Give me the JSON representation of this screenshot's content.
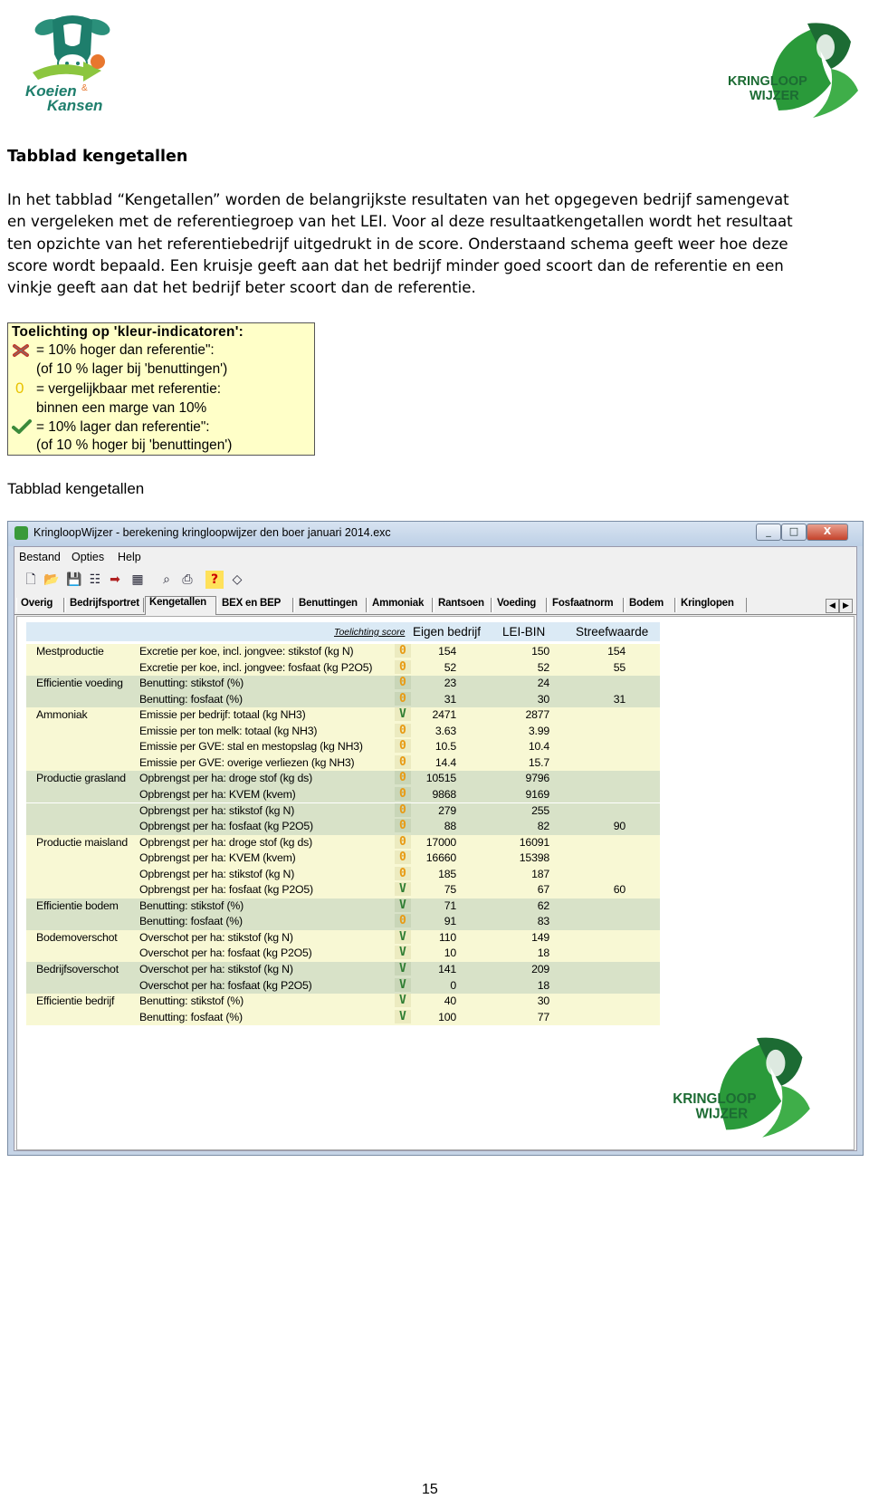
{
  "logos": {
    "left": {
      "name": "Koeien & Kansen",
      "line1": "Koeien",
      "amp": "&",
      "line2": "Kansen"
    },
    "right": {
      "line1": "KRINGLOOP",
      "line2": "WIJZER"
    }
  },
  "heading": "Tabblad kengetallen",
  "intro_lines": [
    "In het tabblad “Kengetallen” worden de belangrijkste resultaten van het opgegeven bedrijf samengevat",
    "en vergeleken met de referentiegroep van het LEI. Voor al deze resultaatkengetallen wordt het resultaat",
    "ten opzichte van het referentiebedrijf uitgedrukt in de score. Onderstaand schema geeft weer hoe deze",
    "score wordt bepaald. Een kruisje geeft aan dat het bedrijf minder goed scoort dan de referentie en een",
    "vinkje geeft aan dat het bedrijf beter scoort dan de referentie."
  ],
  "legend": {
    "title": "Toelichting op 'kleur-indicatoren':",
    "items": [
      {
        "icon": "cross-icon",
        "lines": [
          "= 10% hoger dan referentie\":",
          "(of 10 % lager bij 'benuttingen')"
        ]
      },
      {
        "icon": "zero-icon",
        "symbol": "0",
        "lines": [
          "= vergelijkbaar met referentie:",
          "binnen een marge van 10%"
        ]
      },
      {
        "icon": "check-icon",
        "lines": [
          "= 10% lager dan referentie\":",
          "(of 10 % hoger bij 'benuttingen')"
        ]
      }
    ]
  },
  "subheading": "Tabblad kengetallen",
  "window": {
    "title": "KringloopWijzer - berekening kringloopwijzer den boer januari 2014.exc",
    "controls": [
      "_",
      "□",
      "X"
    ],
    "menu": [
      "Bestand",
      "Opties",
      "Help"
    ],
    "toolbar_icons": [
      "new-file-icon",
      "open-folder-icon",
      "save-icon",
      "print-preview-icon",
      "export-icon",
      "calculator-icon",
      "find-icon",
      "print-icon",
      "help-icon",
      "erase-icon"
    ],
    "tabs": [
      "Overig",
      "Bedrijfsportret",
      "Kengetallen",
      "BEX en BEP",
      "Benuttingen",
      "Ammoniak",
      "Rantsoen",
      "Voeding",
      "Fosfaatnorm",
      "Bodem",
      "Kringlopen"
    ],
    "active_tab": "Kengetallen",
    "table": {
      "toelichting_link": "Toelichting score",
      "columns": [
        "Eigen bedrijf",
        "LEI-BIN",
        "Streefwaarde"
      ],
      "rows": [
        {
          "group": "Mestproductie",
          "label": "Excretie per koe, incl. jongvee: stikstof (kg N)",
          "score": "0",
          "eigen": "154",
          "lei": "150",
          "streef": "154",
          "shade": 1
        },
        {
          "group": "",
          "label": "Excretie per koe, incl. jongvee: fosfaat (kg P2O5)",
          "score": "0",
          "eigen": "52",
          "lei": "52",
          "streef": "55",
          "shade": 1
        },
        {
          "group": "Efficientie voeding",
          "label": "Benutting: stikstof (%)",
          "score": "0",
          "eigen": "23",
          "lei": "24",
          "streef": "",
          "shade": 2
        },
        {
          "group": "",
          "label": "Benutting: fosfaat (%)",
          "score": "0",
          "eigen": "31",
          "lei": "30",
          "streef": "31",
          "shade": 2
        },
        {
          "group": "Ammoniak",
          "label": "Emissie per bedrijf: totaal (kg NH3)",
          "score": "V",
          "eigen": "2471",
          "lei": "2877",
          "streef": "",
          "shade": 1
        },
        {
          "group": "",
          "label": "Emissie per ton melk: totaal (kg NH3)",
          "score": "0",
          "eigen": "3.63",
          "lei": "3.99",
          "streef": "",
          "shade": 1
        },
        {
          "group": "",
          "label": "Emissie per GVE: stal en mestopslag (kg NH3)",
          "score": "0",
          "eigen": "10.5",
          "lei": "10.4",
          "streef": "",
          "shade": 1
        },
        {
          "group": "",
          "label": "Emissie per GVE: overige verliezen (kg NH3)",
          "score": "0",
          "eigen": "14.4",
          "lei": "15.7",
          "streef": "",
          "shade": 1
        },
        {
          "group": "Productie grasland",
          "label": "Opbrengst per ha: droge stof (kg ds)",
          "score": "0",
          "eigen": "10515",
          "lei": "9796",
          "streef": "",
          "shade": 2
        },
        {
          "group": "",
          "label": "Opbrengst per ha: KVEM (kvem)",
          "score": "0",
          "eigen": "9868",
          "lei": "9169",
          "streef": "",
          "shade": 2
        },
        {
          "group": "",
          "label": "Opbrengst per ha: stikstof (kg N)",
          "score": "0",
          "eigen": "279",
          "lei": "255",
          "streef": "",
          "shade": 2
        },
        {
          "group": "",
          "label": "Opbrengst per ha: fosfaat (kg P2O5)",
          "score": "0",
          "eigen": "88",
          "lei": "82",
          "streef": "90",
          "shade": 2
        },
        {
          "group": "Productie maisland",
          "label": "Opbrengst per ha: droge stof (kg ds)",
          "score": "0",
          "eigen": "17000",
          "lei": "16091",
          "streef": "",
          "shade": 1
        },
        {
          "group": "",
          "label": "Opbrengst per ha: KVEM (kvem)",
          "score": "0",
          "eigen": "16660",
          "lei": "15398",
          "streef": "",
          "shade": 1
        },
        {
          "group": "",
          "label": "Opbrengst per ha: stikstof (kg N)",
          "score": "0",
          "eigen": "185",
          "lei": "187",
          "streef": "",
          "shade": 1
        },
        {
          "group": "",
          "label": "Opbrengst per ha: fosfaat (kg P2O5)",
          "score": "V",
          "eigen": "75",
          "lei": "67",
          "streef": "60",
          "shade": 1
        },
        {
          "group": "Efficientie bodem",
          "label": "Benutting: stikstof (%)",
          "score": "V",
          "eigen": "71",
          "lei": "62",
          "streef": "",
          "shade": 2
        },
        {
          "group": "",
          "label": "Benutting: fosfaat (%)",
          "score": "0",
          "eigen": "91",
          "lei": "83",
          "streef": "",
          "shade": 2
        },
        {
          "group": "Bodemoverschot",
          "label": "Overschot per ha: stikstof (kg N)",
          "score": "V",
          "eigen": "110",
          "lei": "149",
          "streef": "",
          "shade": 1
        },
        {
          "group": "",
          "label": "Overschot per ha: fosfaat (kg P2O5)",
          "score": "V",
          "eigen": "10",
          "lei": "18",
          "streef": "",
          "shade": 1
        },
        {
          "group": "Bedrijfsoverschot",
          "label": "Overschot per ha: stikstof (kg N)",
          "score": "V",
          "eigen": "141",
          "lei": "209",
          "streef": "",
          "shade": 2
        },
        {
          "group": "",
          "label": "Overschot per ha: fosfaat (kg P2O5)",
          "score": "V",
          "eigen": "0",
          "lei": "18",
          "streef": "",
          "shade": 2
        },
        {
          "group": "Efficientie bedrijf",
          "label": "Benutting: stikstof (%)",
          "score": "V",
          "eigen": "40",
          "lei": "30",
          "streef": "",
          "shade": 1
        },
        {
          "group": "",
          "label": "Benutting: fosfaat (%)",
          "score": "V",
          "eigen": "100",
          "lei": "77",
          "streef": "",
          "shade": 1
        }
      ]
    }
  },
  "colors": {
    "shade1": "#f8f8d4",
    "shade2": "#d8e2c8",
    "green": "#2a9a3a",
    "dark_green": "#1c6b33",
    "teal": "#0a7d6d",
    "score_zero": "#e89a12",
    "score_v": "#2e7d32"
  },
  "page_number": "15"
}
